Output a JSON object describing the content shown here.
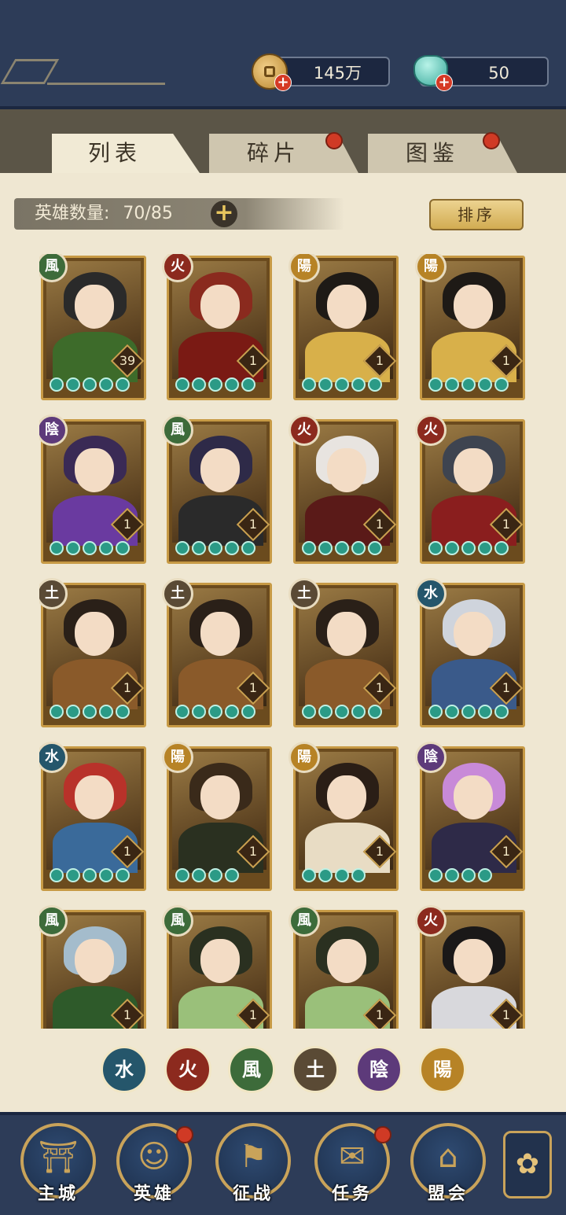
{
  "currency": {
    "coins": "145万",
    "jade": "50"
  },
  "tabs": [
    {
      "label": "列表",
      "active": true,
      "badge": false
    },
    {
      "label": "碎片",
      "active": false,
      "badge": true
    },
    {
      "label": "图鉴",
      "active": false,
      "badge": true
    }
  ],
  "hero_count": {
    "label": "英雄数量:",
    "value": "70/85"
  },
  "sort_label": "排序",
  "elements": {
    "wind": "風",
    "fire": "火",
    "yang": "陽",
    "yin": "陰",
    "earth": "土",
    "water": "水"
  },
  "heroes": [
    {
      "element": "風",
      "level": "39",
      "stars": 5,
      "hair": "#2a2a2a",
      "body": "#3d6b2a"
    },
    {
      "element": "火",
      "level": "1",
      "stars": 5,
      "hair": "#8a2a1e",
      "body": "#7a1a14"
    },
    {
      "element": "陽",
      "level": "1",
      "stars": 5,
      "hair": "#1e1a16",
      "body": "#d8b04a"
    },
    {
      "element": "陽",
      "level": "1",
      "stars": 5,
      "hair": "#1e1a16",
      "body": "#d8b04a"
    },
    {
      "element": "陰",
      "level": "1",
      "stars": 5,
      "hair": "#3a2a55",
      "body": "#6a3aa0"
    },
    {
      "element": "風",
      "level": "1",
      "stars": 5,
      "hair": "#2e2a48",
      "body": "#2a2a2a"
    },
    {
      "element": "火",
      "level": "1",
      "stars": 5,
      "hair": "#e8e4e0",
      "body": "#5a1a18"
    },
    {
      "element": "火",
      "level": "1",
      "stars": 5,
      "hair": "#3e4450",
      "body": "#8a1e1e"
    },
    {
      "element": "土",
      "level": "1",
      "stars": 5,
      "hair": "#2a2018",
      "body": "#8a5a2a"
    },
    {
      "element": "土",
      "level": "1",
      "stars": 5,
      "hair": "#2a2018",
      "body": "#8a5a2a"
    },
    {
      "element": "土",
      "level": "1",
      "stars": 5,
      "hair": "#2a2018",
      "body": "#8a5a2a"
    },
    {
      "element": "水",
      "level": "1",
      "stars": 5,
      "hair": "#cfd4dc",
      "body": "#3a5a8a"
    },
    {
      "element": "水",
      "level": "1",
      "stars": 5,
      "hair": "#b8322a",
      "body": "#3a6a9a"
    },
    {
      "element": "陽",
      "level": "1",
      "stars": 4,
      "hair": "#3a2a1a",
      "body": "#2a3020"
    },
    {
      "element": "陽",
      "level": "1",
      "stars": 4,
      "hair": "#2a1e16",
      "body": "#e8dcc4"
    },
    {
      "element": "陰",
      "level": "1",
      "stars": 4,
      "hair": "#c88ad8",
      "body": "#2e2a48"
    },
    {
      "element": "風",
      "level": "1",
      "stars": 0,
      "hair": "#a4bccc",
      "body": "#2e5a2a"
    },
    {
      "element": "風",
      "level": "1",
      "stars": 0,
      "hair": "#2a3020",
      "body": "#9ac07a"
    },
    {
      "element": "風",
      "level": "1",
      "stars": 0,
      "hair": "#2a3020",
      "body": "#9ac07a"
    },
    {
      "element": "火",
      "level": "1",
      "stars": 0,
      "hair": "#1a1818",
      "body": "#d8d8dc"
    }
  ],
  "filters": [
    "水",
    "火",
    "風",
    "土",
    "陰",
    "陽"
  ],
  "nav": [
    {
      "label": "主城",
      "icon": "city-gate-icon",
      "badge": false
    },
    {
      "label": "英雄",
      "icon": "hero-portrait-icon",
      "badge": true
    },
    {
      "label": "征战",
      "icon": "battle-flag-icon",
      "badge": false
    },
    {
      "label": "任务",
      "icon": "scroll-icon",
      "badge": true
    },
    {
      "label": "盟会",
      "icon": "alliance-pavilion-icon",
      "badge": false
    }
  ],
  "colors": {
    "wind": "#3d6b3a",
    "fire": "#8c2a1e",
    "yang": "#b78326",
    "yin": "#5d3a7a",
    "earth": "#5a4a35",
    "water": "#25566b"
  }
}
